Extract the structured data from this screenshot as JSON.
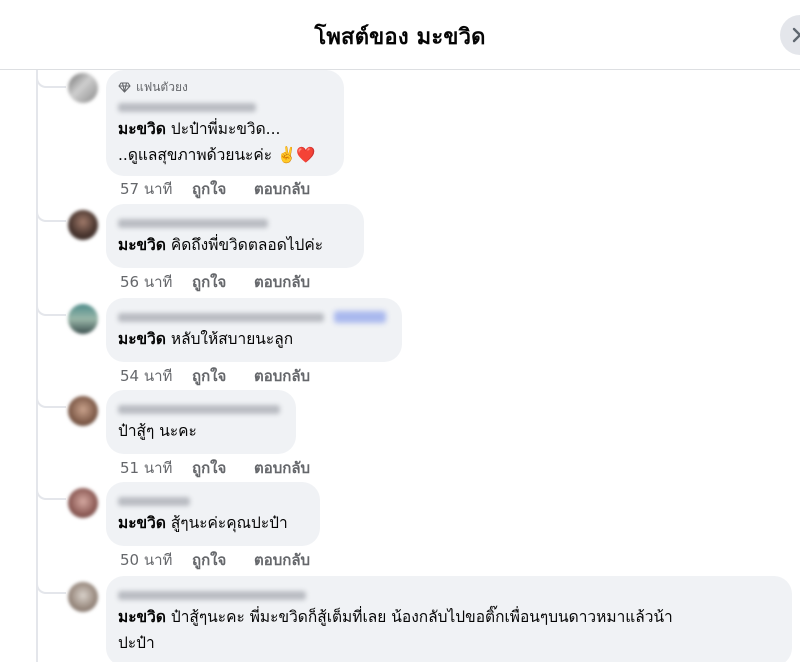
{
  "header": {
    "title": "โพสต์ของ มะขวิด"
  },
  "colors": {
    "bubble": "#f0f2f5",
    "meta_text": "#65676b",
    "thread_line": "#e4e6eb",
    "heart": "#e0245e"
  },
  "comments": [
    {
      "badge": "แฟนตัวยง",
      "lines": [
        {
          "mention": "มะขวิด",
          "text": " ปะป๋าพี่มะขวิด..."
        },
        {
          "mention": "",
          "text": "..ดูแลสุขภาพด้วยนะค่ะ ✌️❤️"
        }
      ],
      "time": "57 นาที",
      "like": "ถูกใจ",
      "reply": "ตอบกลับ"
    },
    {
      "lines": [
        {
          "mention": "มะขวิด",
          "text": " คิดถึงพี่ขวิดตลอดไปค่ะ"
        }
      ],
      "time": "56 นาที",
      "like": "ถูกใจ",
      "reply": "ตอบกลับ"
    },
    {
      "lines": [
        {
          "mention": "มะขวิด",
          "text": " หลับให้สบายนะลูก"
        }
      ],
      "time": "54 นาที",
      "like": "ถูกใจ",
      "reply": "ตอบกลับ"
    },
    {
      "lines": [
        {
          "mention": "",
          "text": "ป๋าสู้ๆ นะคะ"
        }
      ],
      "time": "51 นาที",
      "like": "ถูกใจ",
      "reply": "ตอบกลับ"
    },
    {
      "lines": [
        {
          "mention": "มะขวิด",
          "text": " สู้ๆนะค่ะคุณปะป๋า"
        }
      ],
      "time": "50 นาที",
      "like": "ถูกใจ",
      "reply": "ตอบกลับ"
    },
    {
      "lines": [
        {
          "mention": "มะขวิด",
          "text": " ป๋าสู้ๆนะคะ พี่มะขวิดก็สู้เต็มที่เลย น้องกลับไปขอติ๊กเพื่อนๆบนดาวหมาแล้วน้า"
        },
        {
          "mention": "",
          "text": "ปะป๋า"
        }
      ]
    }
  ]
}
